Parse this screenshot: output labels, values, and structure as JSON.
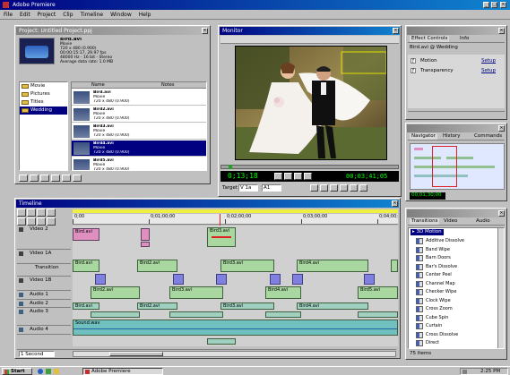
{
  "app": {
    "title": "Adobe Premiere"
  },
  "menu": [
    "File",
    "Edit",
    "Project",
    "Clip",
    "Timeline",
    "Window",
    "Help"
  ],
  "project": {
    "title": "Project: Untitled Project.ppj",
    "clip_info": [
      "Bird.avi",
      "Movie",
      "720 x 480 (0.900)",
      "00:00:15:17, 29.97 fps",
      "48000 Hz - 16 bit - Stereo",
      "Average data rate: 1.0 MB"
    ],
    "bins": [
      "Movie",
      "Pictures",
      "Titles",
      "Wedding"
    ],
    "columns": [
      "Name",
      "Notes"
    ],
    "items": [
      {
        "name": "Bird.avi",
        "type": "Movie",
        "size": "720 x 480 (0.900)"
      },
      {
        "name": "Bird2.avi",
        "type": "Movie",
        "size": "720 x 480 (0.900)"
      },
      {
        "name": "Bird3.avi",
        "type": "Movie",
        "size": "720 x 480 (0.900)"
      },
      {
        "name": "Bird4.avi",
        "type": "Movie",
        "size": "720 x 480 (0.900)"
      },
      {
        "name": "Bird5.avi",
        "type": "Movie",
        "size": "720 x 480 (0.900)"
      }
    ]
  },
  "monitor": {
    "title": "Monitor",
    "timecode_left": "0;13;18",
    "timecode_right": "00;03;41;05",
    "target_label": "Target",
    "target_value": "V 1a",
    "audio_value": "A1"
  },
  "effect_controls": {
    "title": "Effect Controls",
    "tab2": "Info",
    "clip_label": "Bird.avi @ Wedding",
    "rows": [
      {
        "name": "Motion",
        "action": "Setup"
      },
      {
        "name": "Transparency",
        "action": "Setup"
      }
    ]
  },
  "navigator": {
    "tabs": [
      "Navigator",
      "History",
      "Commands"
    ],
    "footer": "00;01;30;00"
  },
  "timeline": {
    "title": "Timeline",
    "ruler": [
      "0;00",
      "0;01;00;00",
      "0;02;00;00",
      "0;03;00;00",
      "0;04;00;00"
    ],
    "tracks": [
      {
        "name": "Video 2",
        "kind": "v"
      },
      {
        "name": "Video 1A",
        "kind": "v"
      },
      {
        "name": "Transition",
        "kind": "t"
      },
      {
        "name": "Video 1B",
        "kind": "v"
      },
      {
        "name": "Audio 1",
        "kind": "a"
      },
      {
        "name": "Audio 2",
        "kind": "a"
      },
      {
        "name": "Audio 3",
        "kind": "a"
      },
      {
        "name": "Audio 4",
        "kind": "a"
      }
    ],
    "clips": {
      "video2": [
        "Bird.avi",
        "Bird3.avi"
      ],
      "video1a": [
        "Bird.avi",
        "Bird2.avi",
        "Bird3.avi",
        "Bird4.avi"
      ],
      "video1b": [
        "Bird2.avi",
        "Bird3.avi",
        "Bird4.avi",
        "Bird5.avi"
      ],
      "audio1": [
        "Bird.avi",
        "Bird2.avi",
        "Bird3.avi",
        "Bird4.avi"
      ],
      "audio3": [
        "Sound.wav"
      ]
    },
    "footer": "1 Second"
  },
  "transitions": {
    "tabs": [
      "Transitions",
      "Video",
      "Audio"
    ],
    "folder": "3D Motion",
    "items": [
      "Additive Dissolve",
      "Band Wipe",
      "Barn Doors",
      "Bar's Dissolve",
      "Center Peel",
      "Channel Map",
      "Checker Wipe",
      "Clock Wipe",
      "Cross Zoom",
      "Cube Spin",
      "Curtain",
      "Cross Dissolve",
      "Direct"
    ],
    "footer": "75 Items"
  },
  "taskbar": {
    "start": "Start",
    "task": "Adobe Premiere",
    "clock": "2:25 PM"
  }
}
